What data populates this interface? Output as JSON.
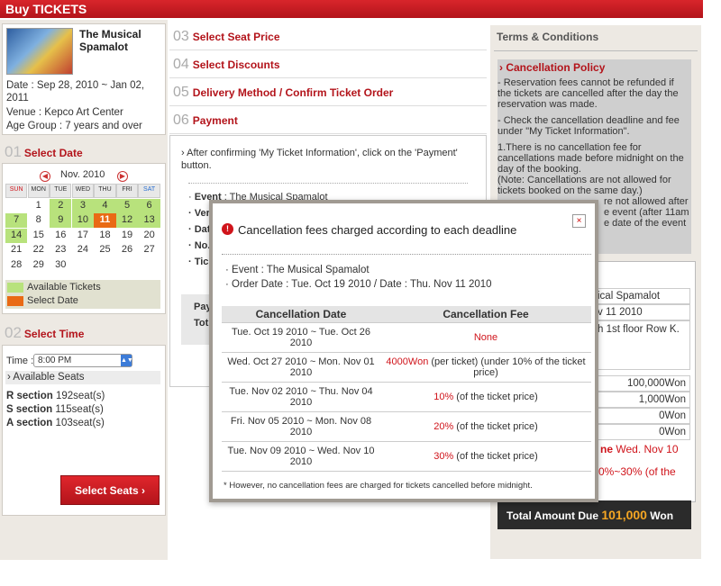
{
  "header": {
    "title": "Buy TICKETS"
  },
  "show": {
    "title": "The Musical Spamalot",
    "date": "Date : Sep 28, 2010 ~ Jan 02, 2011",
    "venue": "Venue : Kepco Art Center",
    "age": "Age Group : 7 years and over"
  },
  "select_date": {
    "num": "01",
    "label": "Select Date"
  },
  "calendar": {
    "month": "Nov. 2010",
    "weekdays": [
      "SUN",
      "MON",
      "TUE",
      "WED",
      "THU",
      "FRI",
      "SAT"
    ],
    "weeks": [
      [
        "",
        "1",
        "2",
        "3",
        "4",
        "5",
        "6"
      ],
      [
        "7",
        "8",
        "9",
        "10",
        "11",
        "12",
        "13"
      ],
      [
        "14",
        "15",
        "16",
        "17",
        "18",
        "19",
        "20"
      ],
      [
        "21",
        "22",
        "23",
        "24",
        "25",
        "26",
        "27"
      ],
      [
        "28",
        "29",
        "30",
        "",
        "",
        "",
        ""
      ]
    ],
    "available": [
      "2",
      "3",
      "4",
      "5",
      "6",
      "7",
      "9",
      "10",
      "12",
      "13",
      "14"
    ],
    "selected": "11"
  },
  "legend": {
    "available": "Available Tickets",
    "selected": "Select Date"
  },
  "select_time": {
    "num": "02",
    "label": "Select Time",
    "time_label": "Time :",
    "time_value": "8:00 PM",
    "seats_heading": "Available Seats",
    "sections": [
      {
        "name": "R section",
        "seats": "192seat(s)"
      },
      {
        "name": "S section",
        "seats": "115seat(s)"
      },
      {
        "name": "A section",
        "seats": "103seat(s)"
      }
    ],
    "button": "Select Seats"
  },
  "steps": [
    {
      "num": "03",
      "label": "Select Seat Price"
    },
    {
      "num": "04",
      "label": "Select Discounts"
    },
    {
      "num": "05",
      "label": "Delivery Method / Confirm Ticket Order"
    },
    {
      "num": "06",
      "label": "Payment"
    }
  ],
  "payment": {
    "instruction": "After confirming 'My Ticket Information', click on the 'Payment' button.",
    "event_label": "Event",
    "event_value": ": The Musical Spamalot",
    "rows": [
      "Ver",
      "Dat",
      "No.",
      "Tic"
    ],
    "pay": "Pay",
    "total": "Tot"
  },
  "terms": {
    "heading": "Terms & Conditions",
    "policy": "Cancellation Policy",
    "items": [
      "Reservation fees cannot be refunded if the tickets are cancelled after the day the reservation was made.",
      "Check the cancellation deadline and fee under \"My Ticket Information\".",
      "1.There is no cancellation fee for cancellations made before midnight on the day of the booking.",
      "(Note: Cancellations are not allowed for tickets booked on the same day.)",
      "re not allowed after",
      "e event (after 11am",
      "e date of the event"
    ]
  },
  "summary": {
    "r1": "ical Spamalot",
    "r2": "v 11 2010",
    "r3": "h 1st floor Row K.",
    "r4": ".",
    "amounts": [
      "100,000Won",
      "1,000Won",
      "0Won",
      "0Won"
    ],
    "warn1": "ne",
    "warn1b": "Wed. Nov 10",
    "warn2": "0%~30% (of the",
    "total_label": "Total Amount Due",
    "total_value": "101,000",
    "total_unit": "Won"
  },
  "modal": {
    "title": "Cancellation fees charged according to each deadline",
    "event": "· Event : The Musical Spamalot",
    "order": "· Order Date : Tue. Oct 19 2010 / Date : Thu. Nov 11 2010",
    "headers": [
      "Cancellation Date",
      "Cancellation Fee"
    ],
    "rows": [
      {
        "date": "Tue. Oct 19 2010 ~ Tue. Oct 26 2010",
        "fee_red": "None",
        "fee": ""
      },
      {
        "date": "Wed. Oct 27 2010 ~ Mon. Nov 01 2010",
        "fee_red": "4000Won",
        "fee": "(per ticket)  (under 10% of the ticket price)"
      },
      {
        "date": "Tue. Nov 02 2010 ~ Thu. Nov 04 2010",
        "fee_red": "10%",
        "fee": "(of the ticket price)"
      },
      {
        "date": "Fri. Nov 05 2010 ~ Mon. Nov 08 2010",
        "fee_red": "20%",
        "fee": "(of the ticket price)"
      },
      {
        "date": "Tue. Nov 09 2010 ~ Wed. Nov 10 2010",
        "fee_red": "30%",
        "fee": "(of the ticket price)"
      }
    ],
    "note": "* However, no cancellation fees are charged for tickets cancelled before midnight.",
    "close": "×"
  },
  "colors": {
    "brand": "#b3141b",
    "available": "#b8e27c",
    "selected": "#e96a14"
  }
}
